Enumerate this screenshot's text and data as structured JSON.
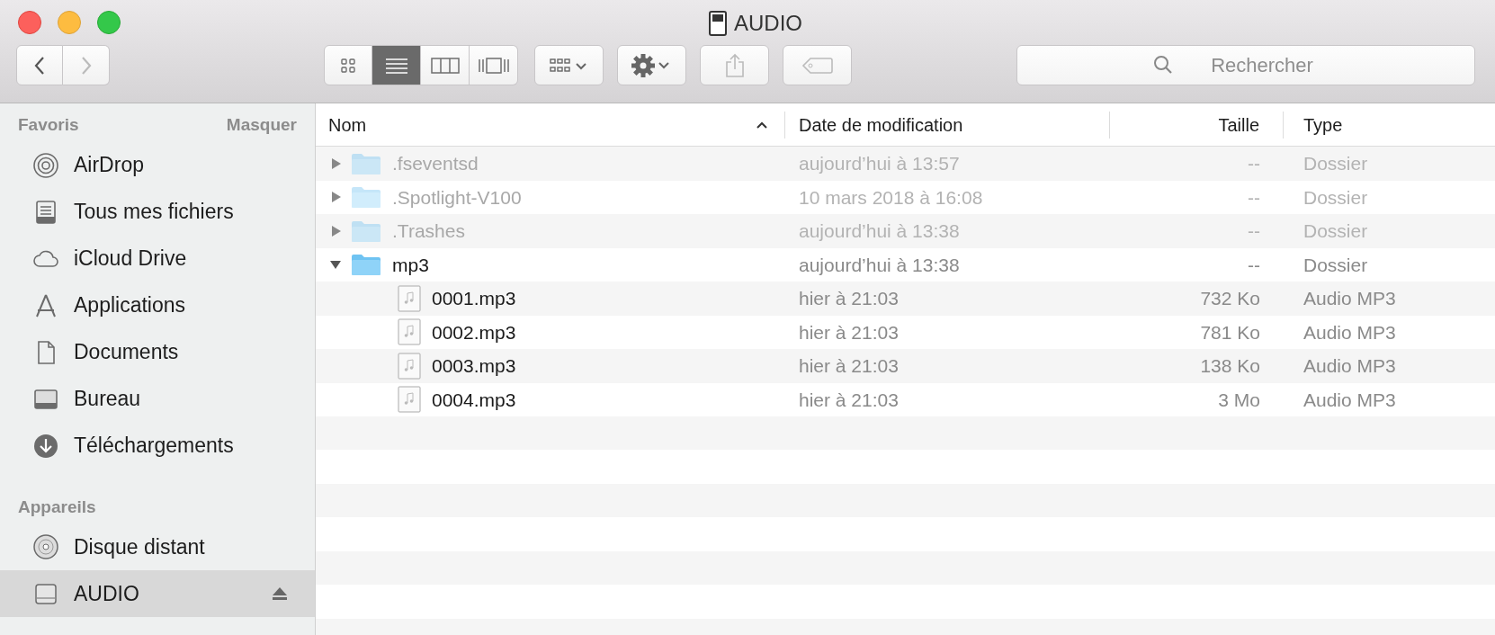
{
  "window": {
    "title": "AUDIO"
  },
  "toolbar": {
    "view_modes": [
      {
        "selected": false
      },
      {
        "selected": true
      },
      {
        "selected": false
      },
      {
        "selected": false
      }
    ],
    "search": {
      "placeholder": "Rechercher"
    }
  },
  "sidebar": {
    "sections": [
      {
        "title": "Favoris",
        "action": "Masquer",
        "items": [
          {
            "label": "AirDrop",
            "selected": false
          },
          {
            "label": "Tous mes fichiers",
            "selected": false
          },
          {
            "label": "iCloud Drive",
            "selected": false
          },
          {
            "label": "Applications",
            "selected": false
          },
          {
            "label": "Documents",
            "selected": false
          },
          {
            "label": "Bureau",
            "selected": false
          },
          {
            "label": "Téléchargements",
            "selected": false
          }
        ]
      },
      {
        "title": "Appareils",
        "items": [
          {
            "label": "Disque distant",
            "selected": false
          },
          {
            "label": "AUDIO",
            "selected": true
          }
        ]
      }
    ]
  },
  "table": {
    "columns": [
      {
        "label": "Nom",
        "sorted": true
      },
      {
        "label": "Date de modification",
        "sorted": false
      },
      {
        "label": "Taille",
        "sorted": false
      },
      {
        "label": "Type",
        "sorted": false
      }
    ],
    "rows": [
      {
        "kind": "folder",
        "name": ".fseventsd",
        "date": "aujourd’hui à 13:57",
        "size": "--",
        "type": "Dossier",
        "expanded": false,
        "dimmed": true
      },
      {
        "kind": "folder",
        "name": ".Spotlight-V100",
        "date": "10 mars 2018 à 16:08",
        "size": "--",
        "type": "Dossier",
        "expanded": false,
        "dimmed": true
      },
      {
        "kind": "folder",
        "name": ".Trashes",
        "date": "aujourd’hui à 13:38",
        "size": "--",
        "type": "Dossier",
        "expanded": false,
        "dimmed": true
      },
      {
        "kind": "folder",
        "name": "mp3",
        "date": "aujourd’hui à 13:38",
        "size": "--",
        "type": "Dossier",
        "expanded": true,
        "dimmed": false,
        "children": [
          {
            "kind": "file",
            "name": "0001.mp3",
            "date": "hier à 21:03",
            "size": "732 Ko",
            "type": "Audio MP3",
            "dimmed": false
          },
          {
            "kind": "file",
            "name": "0002.mp3",
            "date": "hier à 21:03",
            "size": "781 Ko",
            "type": "Audio MP3",
            "dimmed": false
          },
          {
            "kind": "file",
            "name": "0003.mp3",
            "date": "hier à 21:03",
            "size": "138 Ko",
            "type": "Audio MP3",
            "dimmed": false
          },
          {
            "kind": "file",
            "name": "0004.mp3",
            "date": "hier à 21:03",
            "size": "3 Mo",
            "type": "Audio MP3",
            "dimmed": false
          }
        ]
      }
    ]
  }
}
